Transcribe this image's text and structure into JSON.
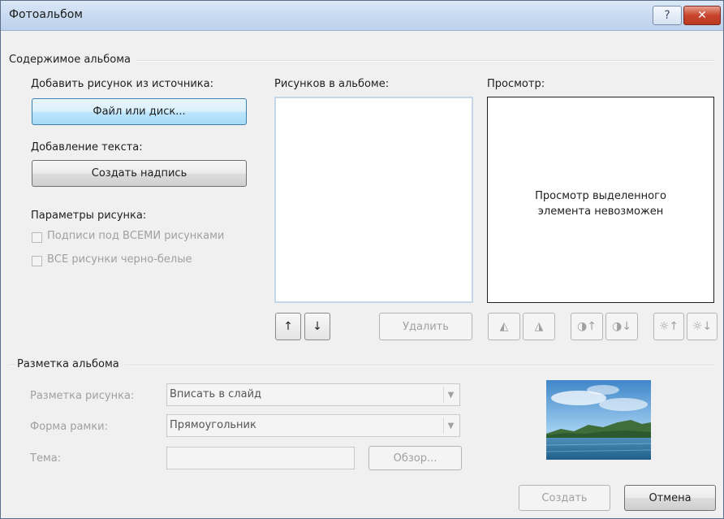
{
  "window": {
    "title": "Фотоальбом",
    "help_glyph": "?",
    "close_glyph": "✕"
  },
  "content": {
    "group_title": "Содержимое альбома",
    "insert_from_label": "Добавить рисунок из источника:",
    "file_button": "Файл или диск...",
    "insert_text_label": "Добавление текста:",
    "new_textbox_button": "Создать надпись",
    "picture_options_label": "Параметры рисунка:",
    "captions_checkbox": "Подписи под ВСЕМИ рисунками",
    "bw_checkbox": "ВСЕ рисунки черно-белые",
    "pictures_list_label": "Рисунков в альбоме:",
    "preview_label": "Просмотр:",
    "preview_message_1": "Просмотр выделенного",
    "preview_message_2": "элемента невозможен",
    "remove_button": "Удалить"
  },
  "icons": {
    "move_up": "↑",
    "move_down": "↓",
    "rotate_left": "◭",
    "rotate_right": "◮",
    "contrast_up": "◑↑",
    "contrast_down": "◑↓",
    "brightness_up": "☼↑",
    "brightness_down": "☼↓"
  },
  "layout_group": {
    "group_title": "Разметка альбома",
    "picture_layout_label": "Разметка рисунка:",
    "picture_layout_value": "Вписать в слайд",
    "frame_shape_label": "Форма рамки:",
    "frame_shape_value": "Прямоугольник",
    "theme_label": "Тема:",
    "theme_value": "",
    "browse_button": "Обзор..."
  },
  "footer": {
    "create_button": "Создать",
    "cancel_button": "Отмена"
  },
  "colors": {
    "title_gradient_top": "#dbe8f7",
    "close_red": "#c8442c",
    "dialog_bg": "#f0f0f0",
    "disabled_text": "#a0a0a0"
  }
}
